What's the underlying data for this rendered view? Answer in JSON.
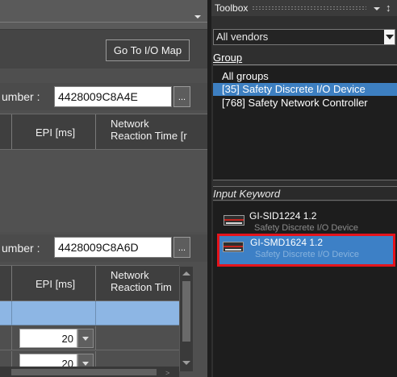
{
  "editor": {
    "goto_button": "Go To I/O Map",
    "serial_label": "umber :",
    "units": [
      {
        "serial": "4428009C8A4E"
      },
      {
        "serial": "4428009C8A6D"
      }
    ],
    "ellipsis": "...",
    "columns": {
      "epi": "EPI [ms]",
      "nrt_top": "Network\nReaction Time [r",
      "nrt_bottom": "Network\nReaction Tim"
    },
    "rows": [
      {
        "epi": "20"
      },
      {
        "epi": "20"
      }
    ]
  },
  "toolbox": {
    "title": "Toolbox",
    "pin_glyph": "↕",
    "vendor": "All vendors",
    "group_label": "Group",
    "groups": [
      {
        "label": "All groups",
        "selected": false
      },
      {
        "label": "[35] Safety Discrete I/O Device",
        "selected": true
      },
      {
        "label": "[768] Safety Network Controller",
        "selected": false
      }
    ],
    "keyword_label": "Input Keyword",
    "devices": [
      {
        "name": "GI-SID1224 1.2",
        "category": "Safety Discrete I/O Device",
        "icon": "io-device-icon",
        "selected": false
      },
      {
        "name": "GI-SMD1624 1.2",
        "category": "Safety Discrete I/O Device",
        "icon": "io-device-icon",
        "selected": true
      }
    ]
  },
  "colors": {
    "selection_blue": "#3d7fc1",
    "highlight_red": "#e4141c",
    "row_selected": "#8db6e4"
  }
}
